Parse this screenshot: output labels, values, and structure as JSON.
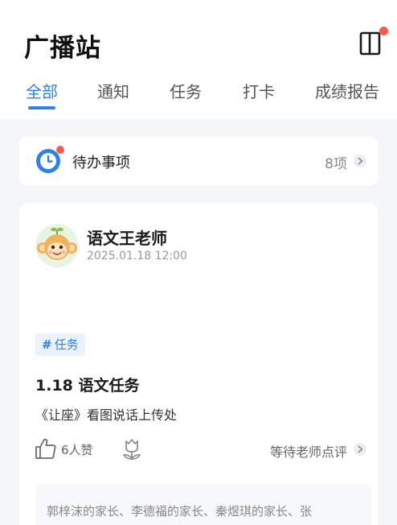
{
  "header": {
    "title": "广播站",
    "panel_icon": "sidebar-panel-icon",
    "has_notification_dot": true
  },
  "tabs": [
    {
      "label": "全部",
      "active": true
    },
    {
      "label": "通知",
      "active": false
    },
    {
      "label": "任务",
      "active": false
    },
    {
      "label": "打卡",
      "active": false
    },
    {
      "label": "成绩报告",
      "active": false
    }
  ],
  "todo": {
    "icon": "clock-icon",
    "label": "待办事项",
    "count": "8项"
  },
  "post": {
    "author": "语文王老师",
    "avatar_icon": "monkey-avatar",
    "time": "2025.01.18 12:00",
    "tag_hash": "#",
    "tag_label": "任务",
    "title": "1.18 语文任务",
    "body": "《让座》看图说话上传处",
    "likes": "6人赞",
    "review_status": "等待老师点评",
    "likers": "郭梓沫的家长、李德福的家长、秦煜琪的家长、张"
  },
  "colors": {
    "accent": "#2f80e8",
    "badge_red": "#f25c54",
    "background": "#f5f6f8",
    "card": "#ffffff",
    "tag_bg": "#eaf3fd"
  }
}
